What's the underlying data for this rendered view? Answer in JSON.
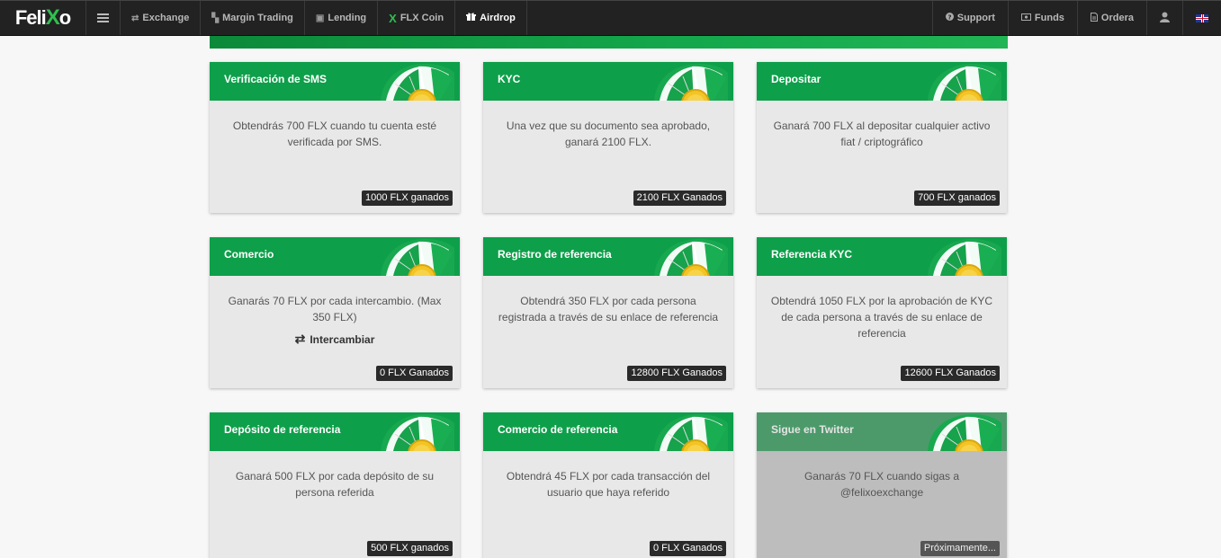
{
  "nav": {
    "logo_text": "Feli",
    "logo_accent": "X",
    "logo_tail": "o",
    "items": [
      {
        "label": "Exchange",
        "icon": "exchange-icon",
        "glyph": "⇄"
      },
      {
        "label": "Margin Trading",
        "icon": "chart-icon",
        "glyph": "▚"
      },
      {
        "label": "Lending",
        "icon": "wallet-icon",
        "glyph": "▣"
      },
      {
        "label": "FLX Coin",
        "icon": "flx-coin-icon",
        "glyph": "X"
      },
      {
        "label": "Airdrop",
        "icon": "gift-icon",
        "glyph": "🎁"
      }
    ],
    "right_items": [
      {
        "label": "Support",
        "icon": "question-icon",
        "glyph": "?"
      },
      {
        "label": "Funds",
        "icon": "money-icon",
        "glyph": "▭"
      },
      {
        "label": "Ordera",
        "icon": "document-icon",
        "glyph": "▤"
      }
    ],
    "user_icon": "user-icon",
    "flag_icon": "uk-flag-icon"
  },
  "cards": [
    {
      "title": "Verificación de SMS",
      "desc": "Obtendrás 700 FLX cuando tu cuenta esté verificada por SMS.",
      "badge": "1000 FLX ganados"
    },
    {
      "title": "KYC",
      "desc": "Una vez que su documento sea aprobado, ganará 2100 FLX.",
      "badge": "2100 FLX Ganados"
    },
    {
      "title": "Depositar",
      "desc": "Ganará 700 FLX al depositar cualquier activo fiat / criptográfico",
      "badge": "700 FLX ganados"
    },
    {
      "title": "Comercio",
      "desc": "Ganarás 70 FLX por cada intercambio. (Max 350 FLX)",
      "action": "Intercambiar",
      "badge": "0 FLX Ganados"
    },
    {
      "title": "Registro de referencia",
      "desc": "Obtendrá 350 FLX por cada persona registrada a través de su enlace de referencia",
      "badge": "12800 FLX Ganados"
    },
    {
      "title": "Referencia KYC",
      "desc": "Obtendrá 1050 FLX por la aprobación de KYC de cada persona a través de su enlace de referencia",
      "badge": "12600 FLX Ganados"
    },
    {
      "title": "Depósito de referencia",
      "desc": "Ganará 500 FLX por cada depósito de su persona referida",
      "badge": "500 FLX ganados"
    },
    {
      "title": "Comercio de referencia",
      "desc": "Obtendrá 45 FLX por cada transacción del usuario que haya referido",
      "badge": "0 FLX Ganados"
    },
    {
      "title": "Sigue en Twitter",
      "desc": "Ganarás 70 FLX cuando sigas a @felixoexchange",
      "badge": "Próximamente..."
    }
  ],
  "colors": {
    "brand_green": "#0e9f4a",
    "nav_bg": "#222222"
  }
}
